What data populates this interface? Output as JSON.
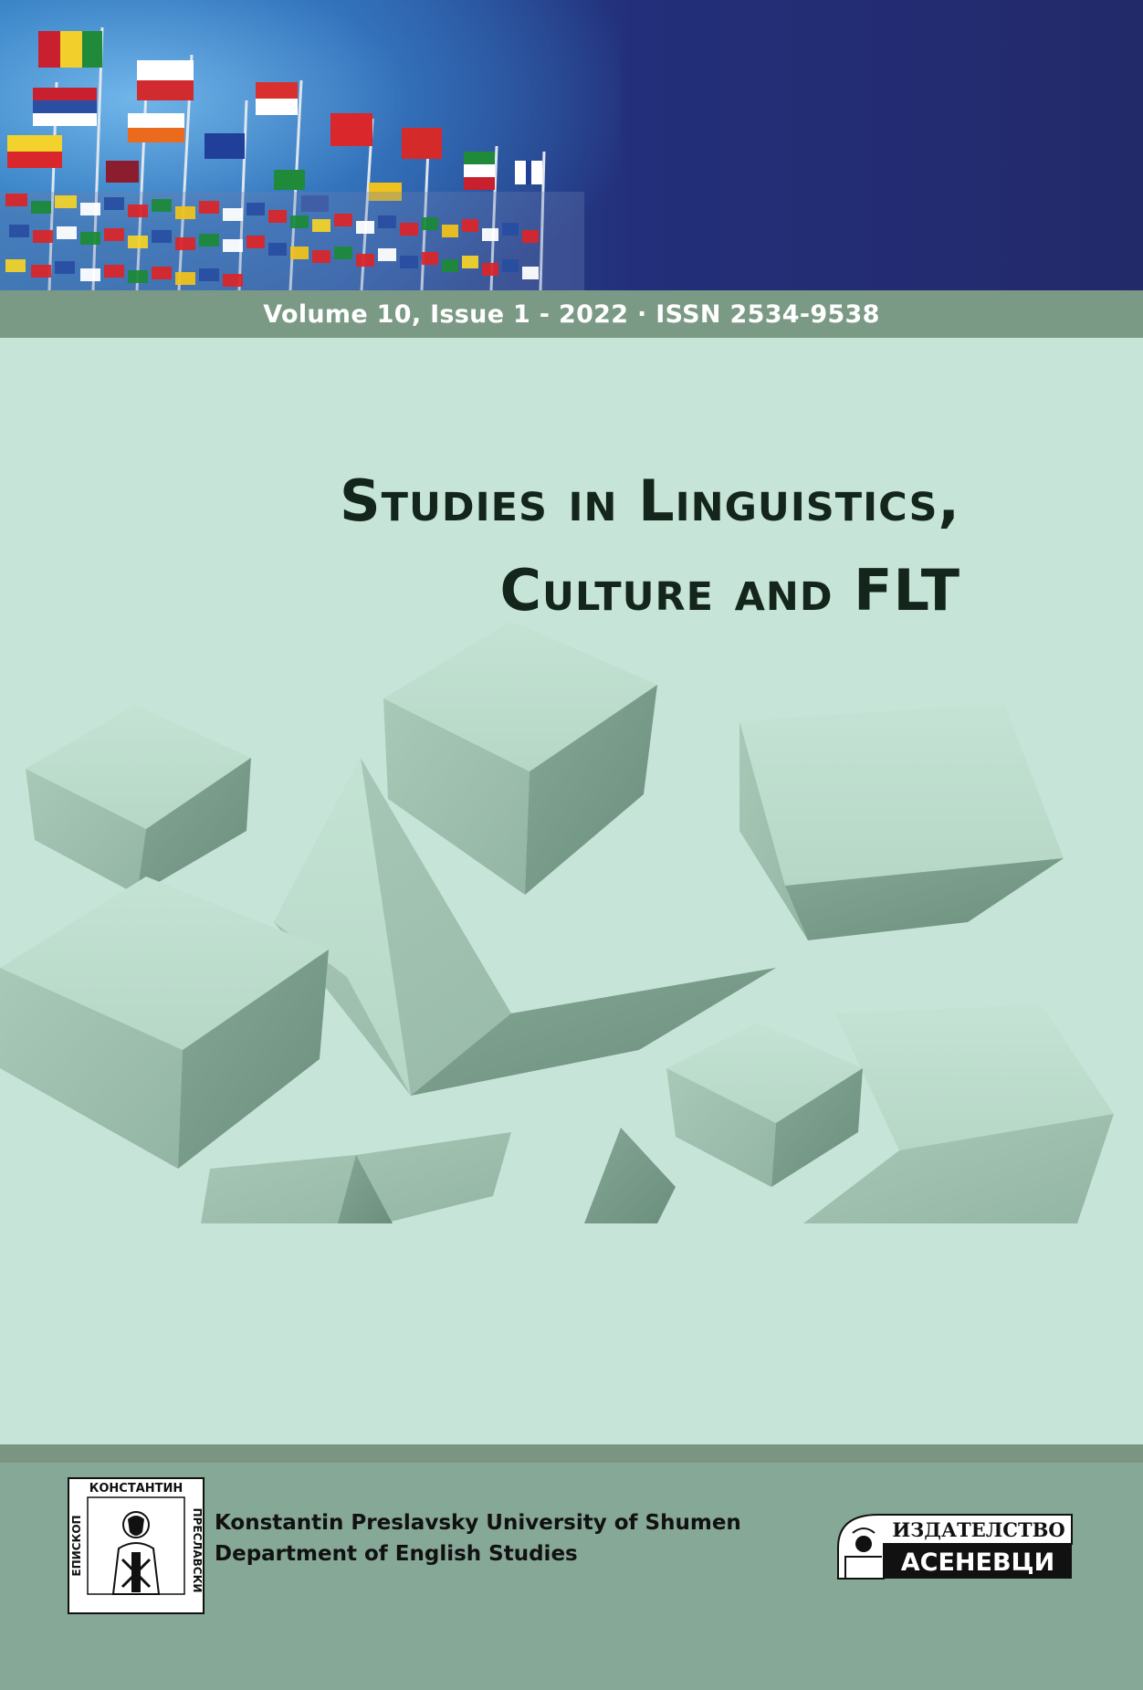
{
  "banner": {
    "volume_line": "Volume 10, Issue 1 - 2022 · ISSN 2534-9538"
  },
  "title": {
    "line1": "Studies in Linguistics,",
    "line2": "Culture and FLT"
  },
  "publisher_block": {
    "university": "Konstantin Preslavsky University of Shumen",
    "department": "Department of English Studies"
  },
  "university_logo": {
    "top_text": "КОНСТАНТИН",
    "left_text": "ЕПИСКОП",
    "right_text": "ПРЕСЛАВСКИ"
  },
  "publisher_logo": {
    "top_text": "ИЗДАТЕЛСТВО",
    "bottom_text": "АСЕНЕВЦИ"
  },
  "colors": {
    "background": "#c6e5d8",
    "band": "#7b9a85",
    "footer": "#86a896",
    "banner_dark": "#232a6a"
  }
}
